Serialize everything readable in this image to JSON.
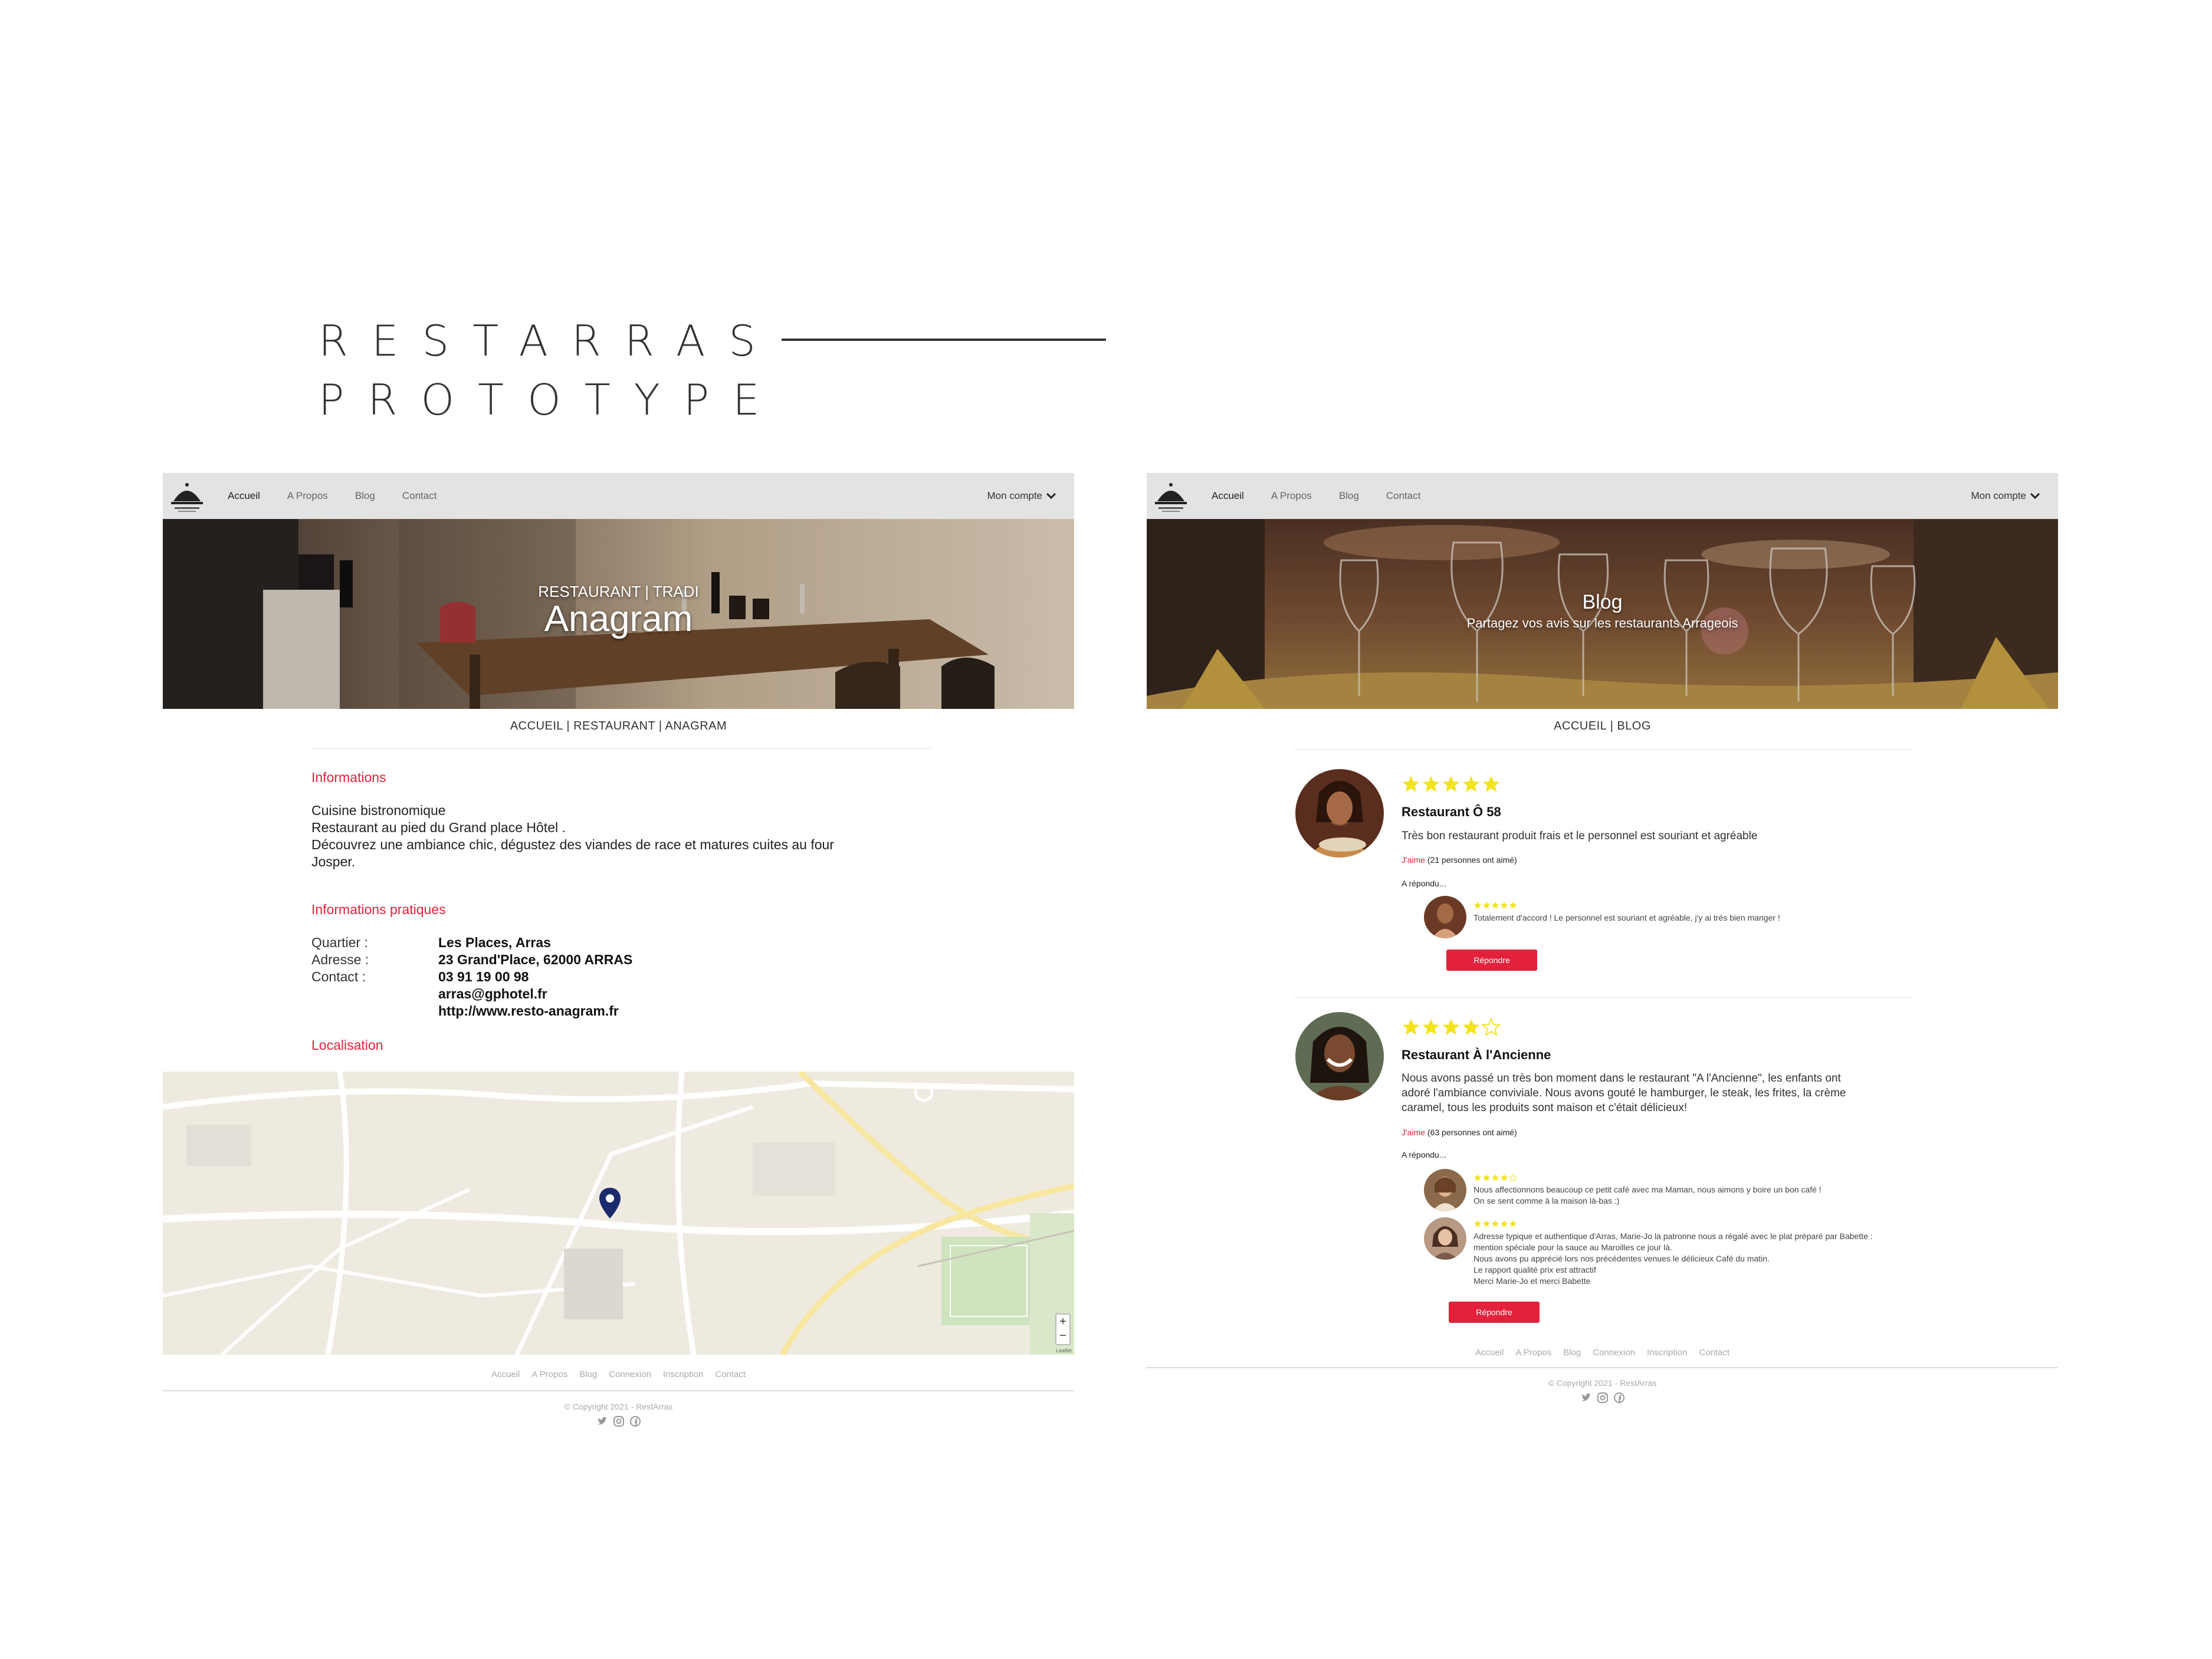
{
  "heading": {
    "line1": "RESTARRAS",
    "line2": "PROTOTYPE"
  },
  "nav": {
    "items": [
      "Accueil",
      "A Propos",
      "Blog",
      "Contact"
    ],
    "account": "Mon compte"
  },
  "restaurant_page": {
    "hero_subtitle": "RESTAURANT | TRADI",
    "hero_title": "Anagram",
    "breadcrumb": "ACCUEIL | RESTAURANT | ANAGRAM",
    "informations_heading": "Informations",
    "description": [
      "Cuisine bistronomique",
      "Restaurant au pied du Grand place Hôtel .",
      "Découvrez une ambiance chic, dégustez des viandes de race et matures cuites au four",
      "Josper."
    ],
    "practical_heading": "Informations pratiques",
    "quartier_label": "Quartier :",
    "quartier": "Les Places, Arras",
    "adresse_label": "Adresse :",
    "adresse": "23 Grand'Place, 62000 ARRAS",
    "contact_label": "Contact :",
    "phone": "03 91 19 00 98",
    "email": "arras@gphotel.fr",
    "website": "http://www.resto-anagram.fr",
    "localisation_heading": "Localisation",
    "map_attribution": "Leaflet"
  },
  "blog_page": {
    "hero_title": "Blog",
    "hero_subtitle": "Partagez vos avis sur les restaurants Arrageois",
    "breadcrumb": "ACCUEIL | BLOG",
    "posts": [
      {
        "rating": 5,
        "title": "Restaurant Ô 58",
        "text": "Très bon restaurant produit frais et le personnel est souriant et agréable",
        "like_word": "J'aime",
        "likes": "(21 personnes ont aimé)",
        "replied_label": "A répondu...",
        "replies": [
          {
            "rating": 5,
            "text": [
              "Totalement d'accord ! Le personnel est souriant et agréable, j'y ai très bien manger !"
            ]
          }
        ],
        "reply_button": "Répondre"
      },
      {
        "rating": 4,
        "title": "Restaurant À l'Ancienne",
        "text": [
          "Nous avons passé un très bon moment dans le restaurant \"A l'Ancienne\", les enfants ont",
          "adoré l'ambiance conviviale. Nous avons gouté le hamburger, le steak, les frites, la crème",
          "caramel, tous les produits sont maison et c'était délicieux!"
        ],
        "like_word": "J'aime",
        "likes": "(63 personnes ont aimé)",
        "replied_label": "A répondu...",
        "replies": [
          {
            "rating": 4,
            "text": [
              "Nous affectionnons beaucoup ce petit café avec ma Maman, nous aimons y boire un bon café !",
              "On se sent comme à la maison là-bas :)"
            ]
          },
          {
            "rating": 5,
            "text": [
              "Adresse typique et authentique d'Arras, Marie-Jo la patronne nous a régalé avec le plat préparé par Babette :",
              "mention spéciale pour la sauce au Maroilles ce jour là.",
              "Nous avons pu apprécié lors nos précédentes venues le délicieux Café du matin.",
              "Le rapport qualité prix est attractif",
              "Merci Marie-Jo et merci Babette"
            ]
          }
        ],
        "reply_button": "Répondre"
      }
    ]
  },
  "footer": {
    "links": [
      "Accueil",
      "A Propos",
      "Blog",
      "Connexion",
      "Inscription",
      "Contact"
    ],
    "copyright": "© Copyright 2021 - RestArras"
  },
  "colors": {
    "accent": "#e3213a",
    "star": "#f2e31b",
    "nav_bg": "#e3e3e3",
    "map_pin": "#1a2a6c"
  },
  "icons": {
    "social": [
      "twitter-icon",
      "instagram-icon",
      "facebook-icon"
    ],
    "logo": "cloche-icon"
  }
}
